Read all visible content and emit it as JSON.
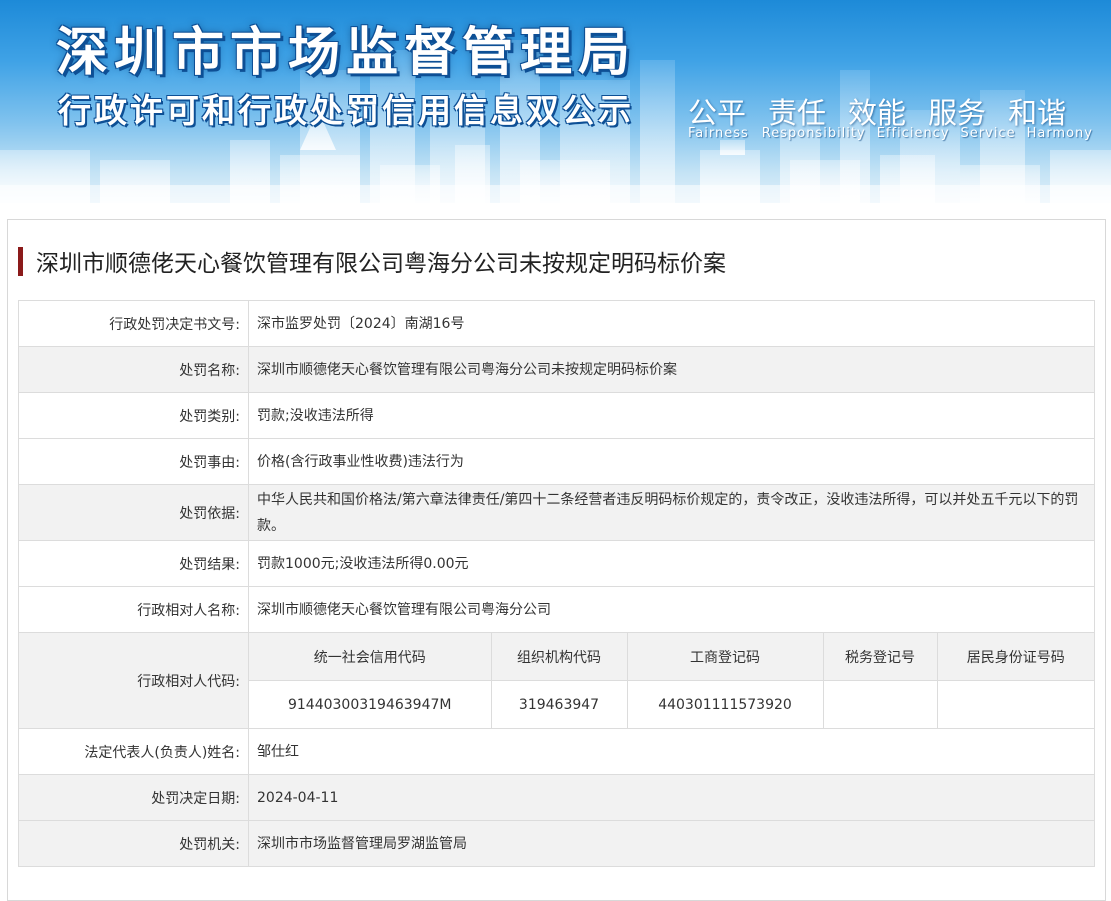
{
  "banner": {
    "title": "深圳市市场监督管理局",
    "subtitle": "行政许可和行政处罚信用信息双公示",
    "slogans": [
      "公平",
      "责任",
      "效能",
      "服务",
      "和谐"
    ],
    "slogans_en": [
      "Fairness",
      "Responsibility",
      "Efficiency",
      "Service",
      "Harmony"
    ]
  },
  "case": {
    "title": "深圳市顺德佬天心餐饮管理有限公司粤海分公司未按规定明码标价案",
    "rows": [
      {
        "label": "行政处罚决定书文号:",
        "value": "深市监罗处罚〔2024〕南湖16号"
      },
      {
        "label": "处罚名称:",
        "value": "深圳市顺德佬天心餐饮管理有限公司粤海分公司未按规定明码标价案"
      },
      {
        "label": "处罚类别:",
        "value": "罚款;没收违法所得"
      },
      {
        "label": "处罚事由:",
        "value": "价格(含行政事业性收费)违法行为"
      },
      {
        "label": "处罚依据:",
        "value": "中华人民共和国价格法/第六章法律责任/第四十二条经营者违反明码标价规定的，责令改正，没收违法所得，可以并处五千元以下的罚款。"
      },
      {
        "label": "处罚结果:",
        "value": "罚款1000元;没收违法所得0.00元"
      },
      {
        "label": "行政相对人名称:",
        "value": "深圳市顺德佬天心餐饮管理有限公司粤海分公司"
      }
    ],
    "codes": {
      "label": "行政相对人代码:",
      "headers": [
        "统一社会信用代码",
        "组织机构代码",
        "工商登记码",
        "税务登记号",
        "居民身份证号码"
      ],
      "values": [
        "91440300319463947M",
        "319463947",
        "440301111573920",
        "",
        ""
      ]
    },
    "rows_after": [
      {
        "label": "法定代表人(负责人)姓名:",
        "value": "邹仕红"
      },
      {
        "label": "处罚决定日期:",
        "value": "2024-04-11"
      },
      {
        "label": "处罚机关:",
        "value": "深圳市市场监督管理局罗湖监管局"
      }
    ]
  },
  "colors": {
    "title_bar": "#8b1a1a",
    "banner_blue": "#1d8ad8",
    "row_alt": "#f2f2f2",
    "border": "#dcdcdc"
  }
}
